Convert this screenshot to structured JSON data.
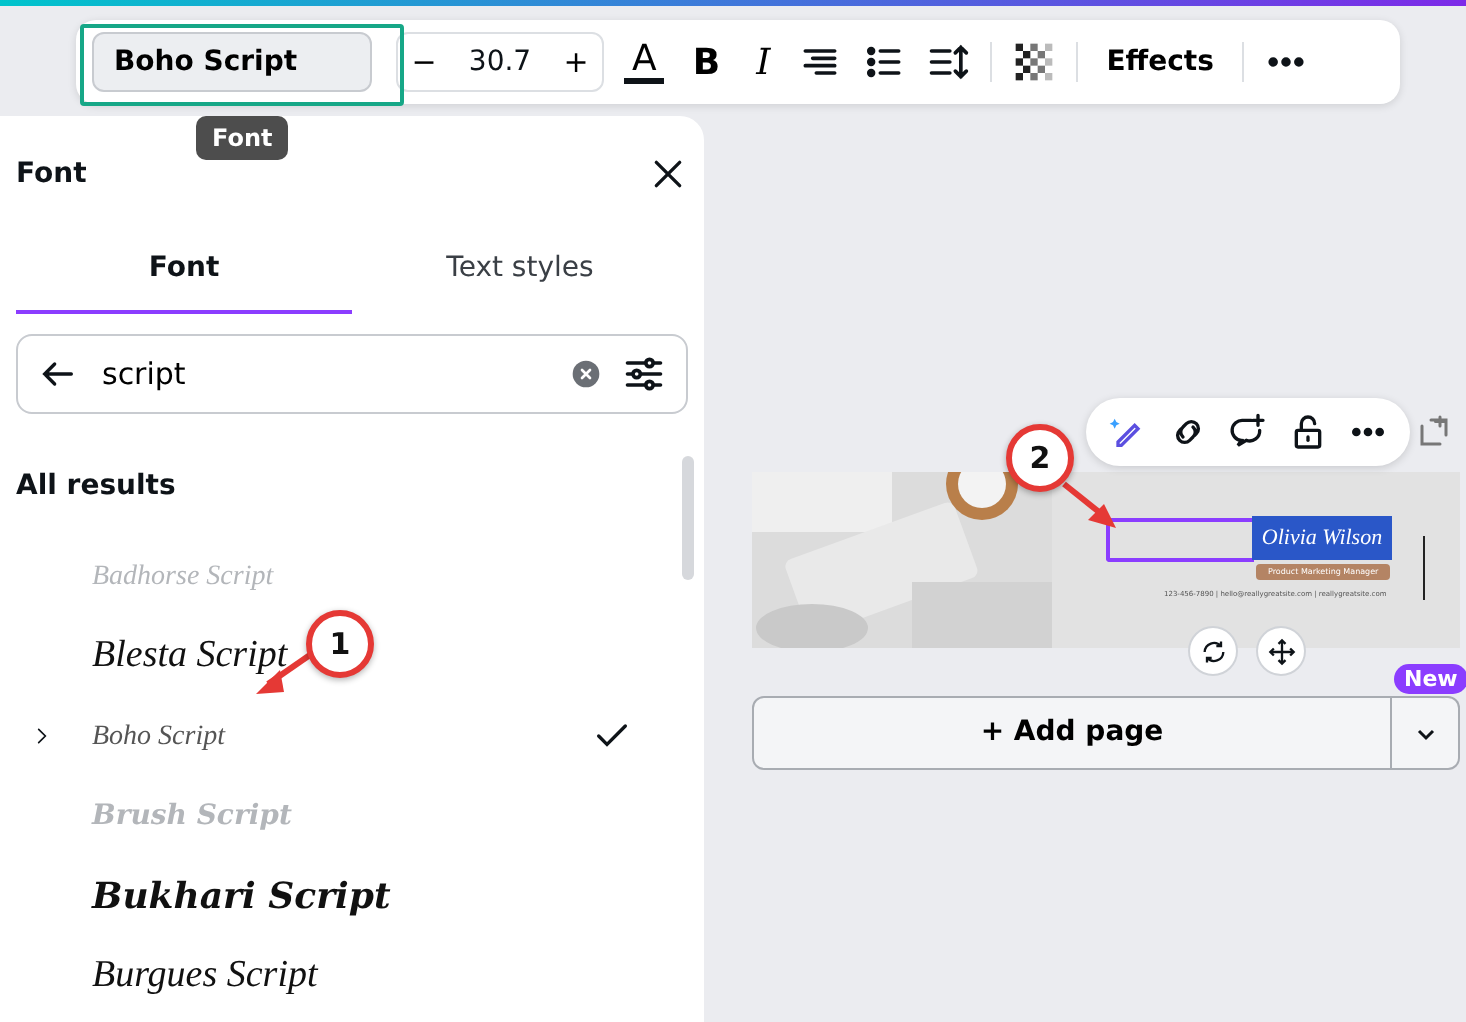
{
  "toolbar": {
    "font_button": {
      "label": "Boho Script",
      "highlighted": true
    },
    "tooltip": "Font",
    "size": {
      "minus": "−",
      "value": "30.7",
      "plus": "+"
    },
    "text_color": "A",
    "bold": "B",
    "italic": "I",
    "effects": "Effects"
  },
  "font_panel": {
    "title": "Font",
    "tabs": [
      {
        "label": "Font",
        "selected": true
      },
      {
        "label": "Text styles",
        "selected": false
      }
    ],
    "search": {
      "value": "script"
    },
    "section": "All results",
    "fonts": [
      {
        "name": "Badhorse Script",
        "kind": "thin",
        "dimmed": true,
        "selected": false
      },
      {
        "name": "Blesta Script",
        "kind": "flourish",
        "dimmed": false,
        "selected": false
      },
      {
        "name": "Boho Script",
        "kind": "thin",
        "dimmed": false,
        "selected": true
      },
      {
        "name": "Brush Script",
        "kind": "brush",
        "dimmed": true,
        "selected": false
      },
      {
        "name": "Bukhari Script",
        "kind": "bold",
        "dimmed": false,
        "selected": false
      },
      {
        "name": "Burgues Script",
        "kind": "flourish",
        "dimmed": false,
        "selected": false
      }
    ]
  },
  "canvas": {
    "name": "Olivia Wilson",
    "role": "Product Marketing Manager",
    "contact": "123-456-7890 | hello@reallygreatsite.com | reallygreatsite.com"
  },
  "add_page": {
    "label": "+ Add page",
    "badge": "New"
  },
  "annotations": [
    {
      "label": "1"
    },
    {
      "label": "2"
    }
  ]
}
